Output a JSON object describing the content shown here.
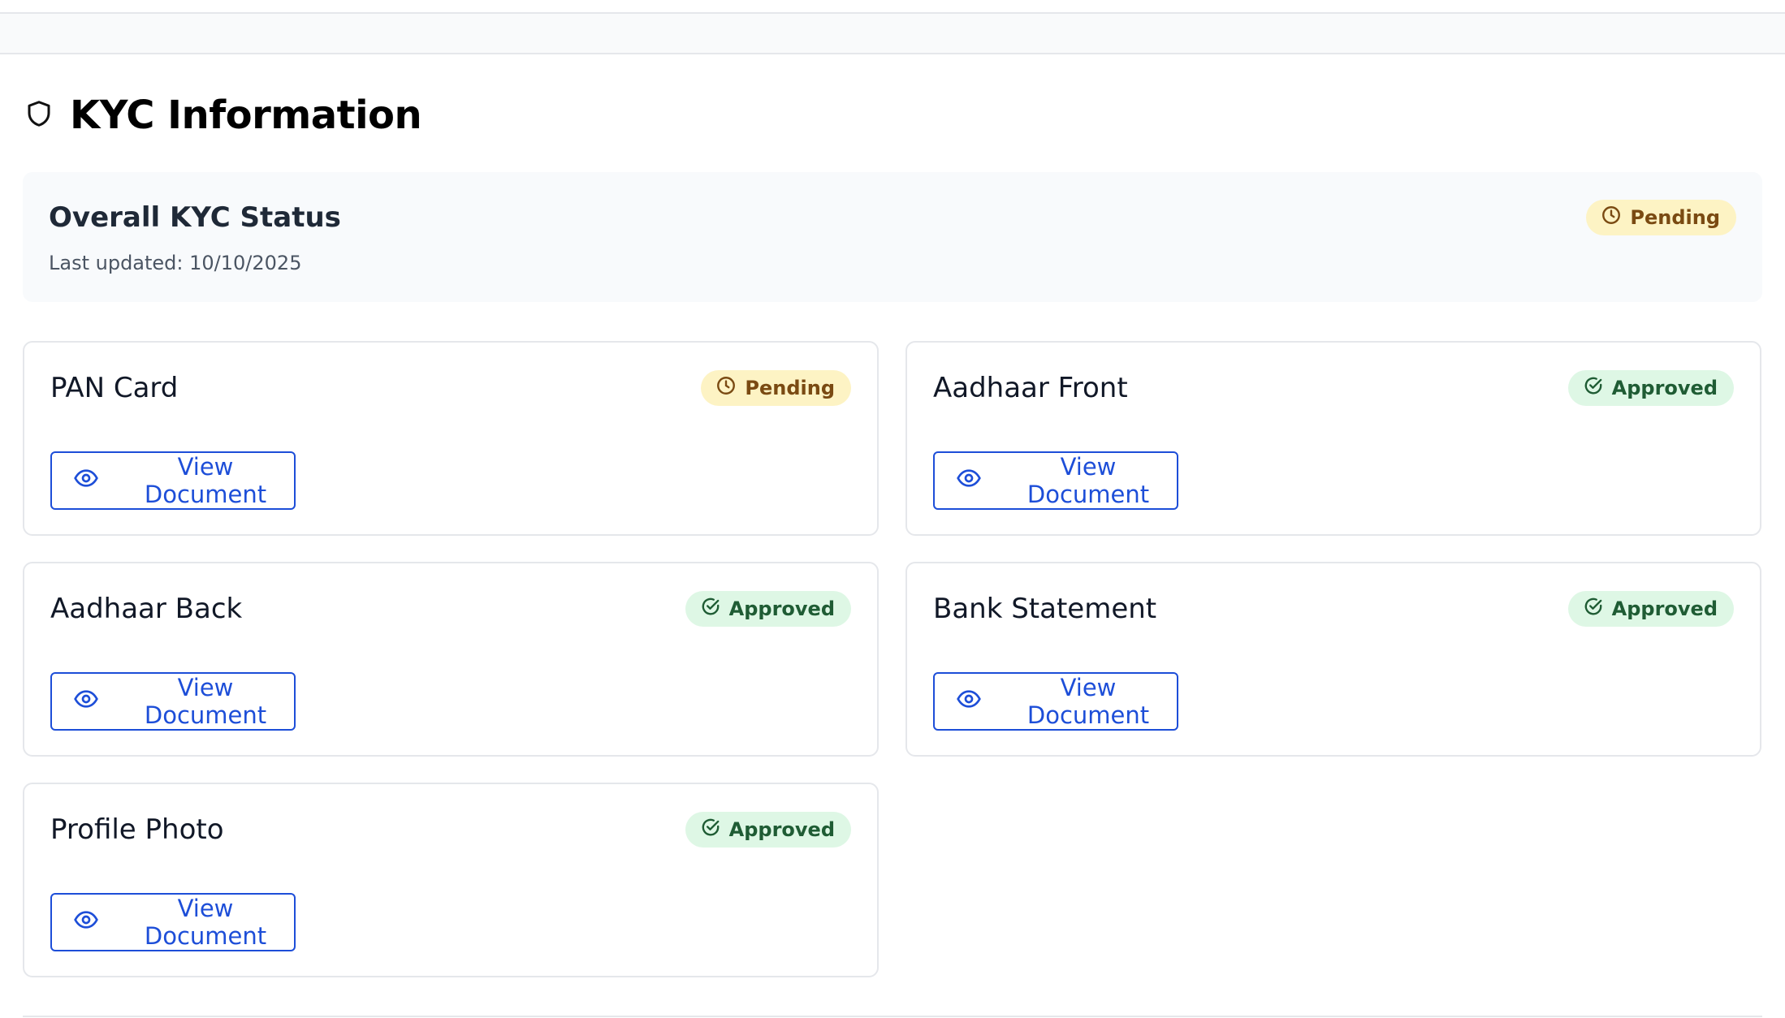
{
  "header": {
    "title": "KYC Information",
    "icon": "shield-icon"
  },
  "overall": {
    "title": "Overall KYC Status",
    "last_updated": "Last updated: 10/10/2025",
    "status": "Pending",
    "status_icon": "clock-icon"
  },
  "colors": {
    "pending_bg": "#fdf3c4",
    "pending_text": "#7a4a12",
    "approved_bg": "#def7e5",
    "approved_text": "#1f5c34",
    "accent": "#1d4ed8"
  },
  "documents": [
    {
      "name": "PAN Card",
      "status": "Pending",
      "status_icon": "clock-icon",
      "button_label": "View Document"
    },
    {
      "name": "Aadhaar Front",
      "status": "Approved",
      "status_icon": "check-circle-icon",
      "button_label": "View Document"
    },
    {
      "name": "Aadhaar Back",
      "status": "Approved",
      "status_icon": "check-circle-icon",
      "button_label": "View Document"
    },
    {
      "name": "Bank Statement",
      "status": "Approved",
      "status_icon": "check-circle-icon",
      "button_label": "View Document"
    },
    {
      "name": "Profile Photo",
      "status": "Approved",
      "status_icon": "check-circle-icon",
      "button_label": "View Document"
    }
  ]
}
